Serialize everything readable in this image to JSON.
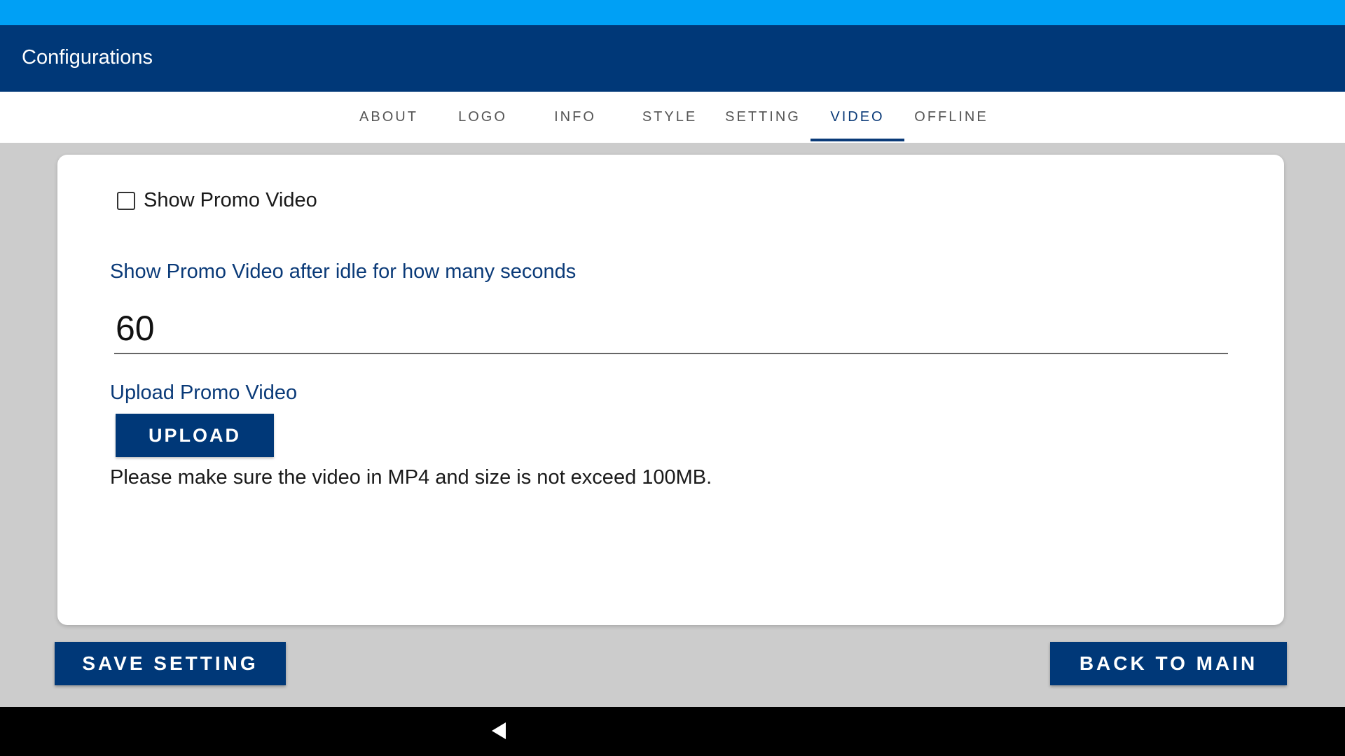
{
  "app": {
    "title": "Configurations"
  },
  "tabs": [
    {
      "label": "ABOUT",
      "active": false
    },
    {
      "label": "LOGO",
      "active": false
    },
    {
      "label": "INFO",
      "active": false
    },
    {
      "label": "STYLE",
      "active": false
    },
    {
      "label": "SETTING",
      "active": false
    },
    {
      "label": "VIDEO",
      "active": true
    },
    {
      "label": "OFFLINE",
      "active": false
    }
  ],
  "video": {
    "show_promo_label": "Show Promo Video",
    "show_promo_checked": false,
    "idle_label": "Show Promo Video after idle for how many seconds",
    "idle_seconds": "60",
    "upload_label": "Upload Promo Video",
    "upload_button": "UPLOAD",
    "hint": "Please make sure the video in MP4 and size is not exceed 100MB."
  },
  "footer": {
    "save_label": "SAVE SETTING",
    "back_label": "BACK TO MAIN"
  },
  "system_nav": {
    "back_icon": "triangle-back-icon"
  },
  "colors": {
    "status_bar": "#00a0f5",
    "primary": "#003878",
    "background": "#cccccc",
    "card": "#ffffff"
  }
}
